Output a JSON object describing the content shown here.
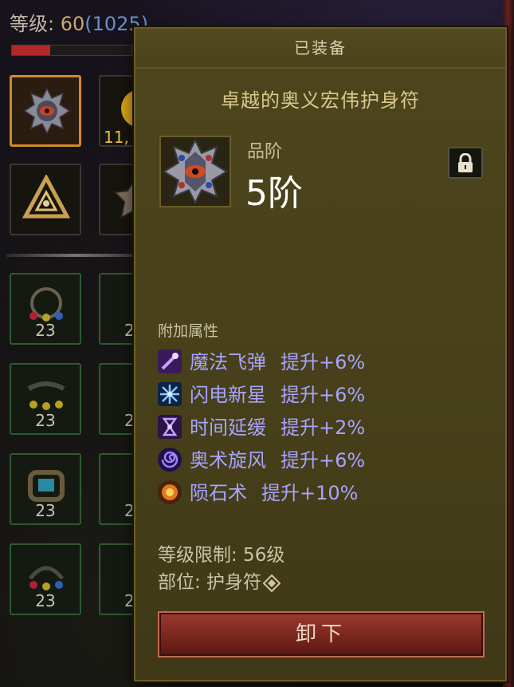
{
  "status": {
    "level_label": "等级: ",
    "level_value": "60",
    "paragon": "(1025)",
    "xp_progress": 0.32
  },
  "inventory": {
    "gold_count": "11,",
    "slot_counts": [
      "23",
      "23",
      "23",
      "23"
    ],
    "partial_counts": [
      "2",
      "2",
      "2",
      "2"
    ]
  },
  "tooltip": {
    "header": "已装备",
    "item_name": "卓越的奥义宏伟护身符",
    "tier_label": "品阶",
    "tier_value": "5阶",
    "icons": {
      "lock": "lock-icon",
      "item": "amulet-icon"
    },
    "affix_title": "附加属性",
    "affixes": [
      {
        "skill": "魔法飞弹",
        "bonus": "提升+6%",
        "icon": "magic-missile-icon",
        "color": "#7a3fc4"
      },
      {
        "skill": "闪电新星",
        "bonus": "提升+6%",
        "icon": "lightning-nova-icon",
        "color": "#2a4fa8"
      },
      {
        "skill": "时间延缓",
        "bonus": "提升+2%",
        "icon": "slow-time-icon",
        "color": "#6a3aa0"
      },
      {
        "skill": "奥术旋风",
        "bonus": "提升+6%",
        "icon": "arcane-wind-icon",
        "color": "#5a2ec0"
      },
      {
        "skill": "陨石术",
        "bonus": "提升+10%",
        "icon": "meteor-icon",
        "color": "#c06a20"
      }
    ],
    "level_requirement": "等级限制: 56级",
    "slot_text": "部位: 护身符",
    "unequip_button": "卸下"
  },
  "colors": {
    "affix_text": "#a8a4ff",
    "panel_bg": "#4a421b",
    "button_red": "#7a261e",
    "selected_slot_border": "#d28a2a"
  }
}
